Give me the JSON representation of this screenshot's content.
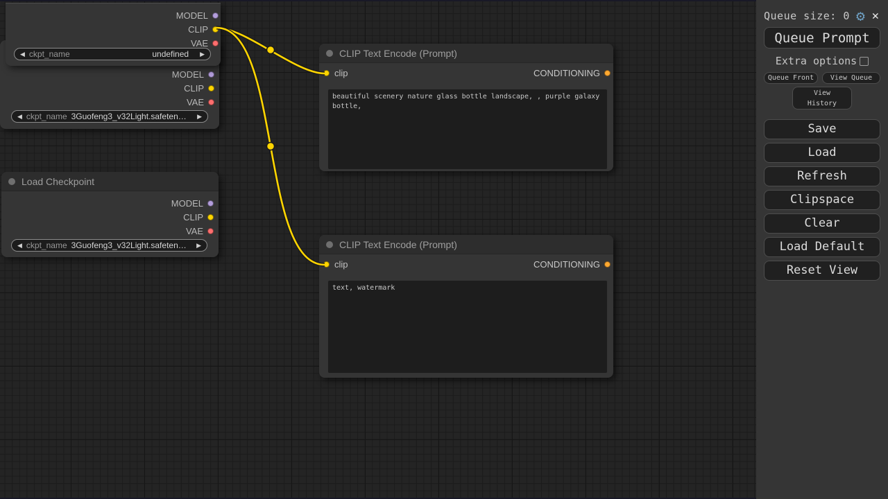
{
  "colors": {
    "model": "#b39ddb",
    "clip": "#ffd500",
    "vae": "#ff6e6e",
    "conditioning": "#ffa931",
    "link": "#ffd500",
    "link_outline": "#1a1a1a",
    "gear": "#6e9fc2"
  },
  "nodes": {
    "ckpt_top": {
      "outputs": [
        "MODEL",
        "CLIP",
        "VAE"
      ],
      "widget": {
        "label": "ckpt_name",
        "value": "undefined"
      }
    },
    "ckpt_mid": {
      "outputs": [
        "MODEL",
        "CLIP",
        "VAE"
      ],
      "widget": {
        "label": "ckpt_name",
        "value": "3Guofeng3_v32Light.safeten…"
      }
    },
    "load_checkpoint": {
      "title": "Load Checkpoint",
      "outputs": [
        "MODEL",
        "CLIP",
        "VAE"
      ],
      "widget": {
        "label": "ckpt_name",
        "value": "3Guofeng3_v32Light.safeten…"
      }
    },
    "clip_pos": {
      "title": "CLIP Text Encode (Prompt)",
      "input_label": "clip",
      "output_label": "CONDITIONING",
      "text": "beautiful scenery nature glass bottle landscape, , purple galaxy bottle,"
    },
    "clip_neg": {
      "title": "CLIP Text Encode (Prompt)",
      "input_label": "clip",
      "output_label": "CONDITIONING",
      "text": "text, watermark"
    }
  },
  "panel": {
    "queue_size_label": "Queue size:",
    "queue_count": "0",
    "icons": {
      "gear": "⚙",
      "close": "✕"
    },
    "buttons": {
      "queue_prompt": "Queue Prompt",
      "extra_options": "Extra options",
      "queue_front": "Queue Front",
      "view_queue": "View Queue",
      "view_history": "View\nHistory",
      "save": "Save",
      "load": "Load",
      "refresh": "Refresh",
      "clipspace": "Clipspace",
      "clear": "Clear",
      "load_default": "Load Default",
      "reset_view": "Reset View"
    }
  }
}
